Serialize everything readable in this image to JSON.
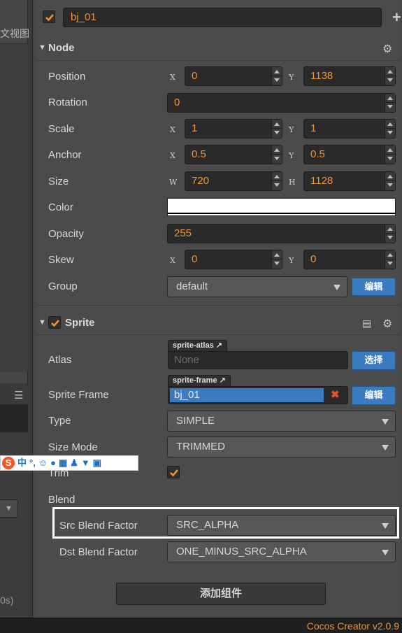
{
  "left_panel": {
    "label_partial": "文视图",
    "menu_icon": "hamburger-icon",
    "stats_partial": "0s)"
  },
  "ime_toolbar": {
    "logo": "S",
    "lang": "中",
    "punct": "°,",
    "icons": [
      "emoji-icon",
      "mic-icon",
      "keyboard-icon",
      "user-icon",
      "shirt-icon",
      "grid-icon"
    ]
  },
  "node_header": {
    "enabled": true,
    "name": "bj_01",
    "add_icon": "+"
  },
  "node_section": {
    "title": "Node",
    "props": {
      "position": {
        "label": "Position",
        "x": "0",
        "y": "1138"
      },
      "rotation": {
        "label": "Rotation",
        "value": "0"
      },
      "scale": {
        "label": "Scale",
        "x": "1",
        "y": "1"
      },
      "anchor": {
        "label": "Anchor",
        "x": "0.5",
        "y": "0.5"
      },
      "size": {
        "label": "Size",
        "w": "720",
        "h": "1128"
      },
      "color": {
        "label": "Color",
        "value": "#ffffff"
      },
      "opacity": {
        "label": "Opacity",
        "value": "255"
      },
      "skew": {
        "label": "Skew",
        "x": "0",
        "y": "0"
      },
      "group": {
        "label": "Group",
        "value": "default",
        "edit_button": "编辑"
      }
    },
    "axis_labels": {
      "x": "X",
      "y": "Y",
      "w": "W",
      "h": "H"
    }
  },
  "sprite_section": {
    "title": "Sprite",
    "enabled": true,
    "atlas": {
      "label": "Atlas",
      "tag": "sprite-atlas",
      "value": "None",
      "button": "选择"
    },
    "sprite_frame": {
      "label": "Sprite Frame",
      "tag": "sprite-frame",
      "value": "bj_01",
      "button": "编辑",
      "clear": "✖"
    },
    "type": {
      "label": "Type",
      "value": "SIMPLE"
    },
    "size_mode": {
      "label": "Size Mode",
      "value": "TRIMMED"
    },
    "trim": {
      "label": "Trim",
      "checked": true
    },
    "blend": {
      "label": "Blend",
      "src": {
        "label": "Src Blend Factor",
        "value": "SRC_ALPHA"
      },
      "dst": {
        "label": "Dst Blend Factor",
        "value": "ONE_MINUS_SRC_ALPHA"
      }
    }
  },
  "add_component_button": "添加组件",
  "status": {
    "version": "Cocos Creator v2.0.9"
  },
  "colors": {
    "accent": "#f29432",
    "button_blue": "#3b7bc2",
    "panel": "#4b4b4b"
  }
}
